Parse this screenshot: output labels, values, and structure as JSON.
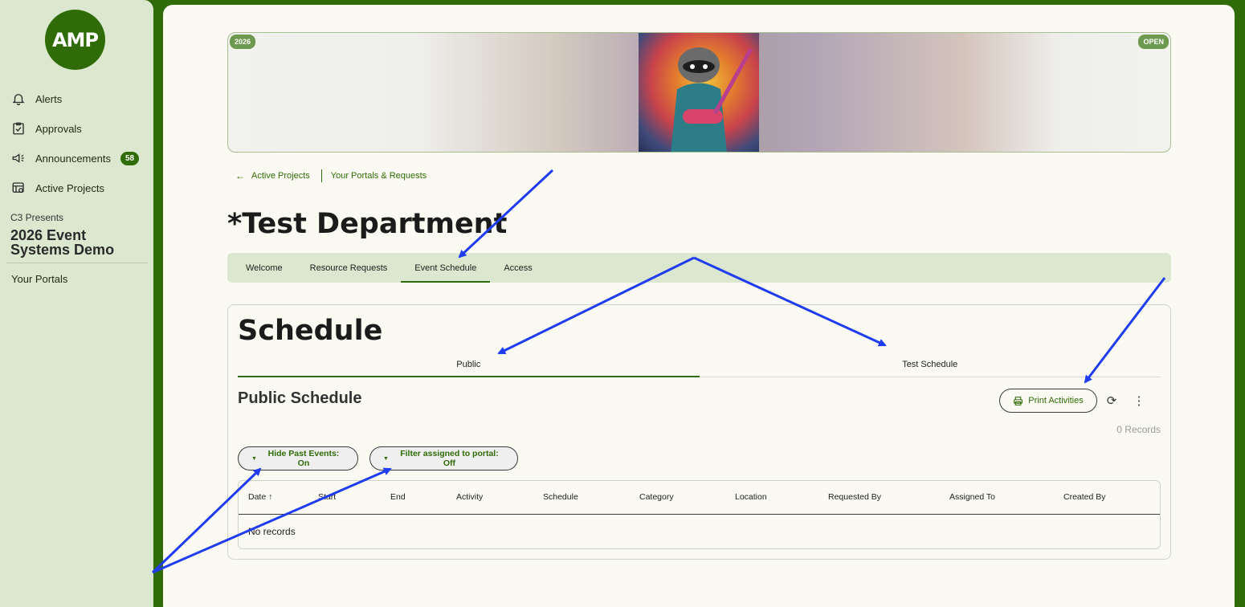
{
  "sidebar": {
    "logo_text": "AMP",
    "items": [
      {
        "label": "Alerts",
        "icon": "bell-icon"
      },
      {
        "label": "Approvals",
        "icon": "checklist-icon"
      },
      {
        "label": "Announcements",
        "icon": "megaphone-icon",
        "badge": "58"
      },
      {
        "label": "Active Projects",
        "icon": "projects-icon"
      }
    ],
    "presenter": "C3 Presents",
    "project_title": "2026 Event Systems Demo",
    "your_portals": "Your Portals"
  },
  "banner": {
    "year_tag": "2026",
    "status_tag": "OPEN"
  },
  "breadcrumb": {
    "back_label": "Active Projects",
    "current_label": "Your Portals & Requests"
  },
  "page_title": "*Test Department",
  "tabs": [
    {
      "label": "Welcome"
    },
    {
      "label": "Resource Requests"
    },
    {
      "label": "Event Schedule",
      "active": true
    },
    {
      "label": "Access"
    }
  ],
  "schedule": {
    "title": "Schedule",
    "sub_tabs": [
      {
        "label": "Public",
        "active": true
      },
      {
        "label": "Test Schedule"
      }
    ],
    "section_title": "Public Schedule",
    "print_label": "Print Activities",
    "records_label": "0 Records",
    "filters": [
      {
        "label": "Hide Past Events: On"
      },
      {
        "label": "Filter assigned to portal: Off"
      }
    ],
    "columns": [
      "Date",
      "Start",
      "End",
      "Activity",
      "Schedule",
      "Category",
      "Location",
      "Requested By",
      "Assigned To",
      "Created By"
    ],
    "empty_text": "No records"
  },
  "colors": {
    "brand": "#2f6b06",
    "sidebar_bg": "#dbe8cf",
    "annotation_arrow": "#1f3cf0"
  }
}
